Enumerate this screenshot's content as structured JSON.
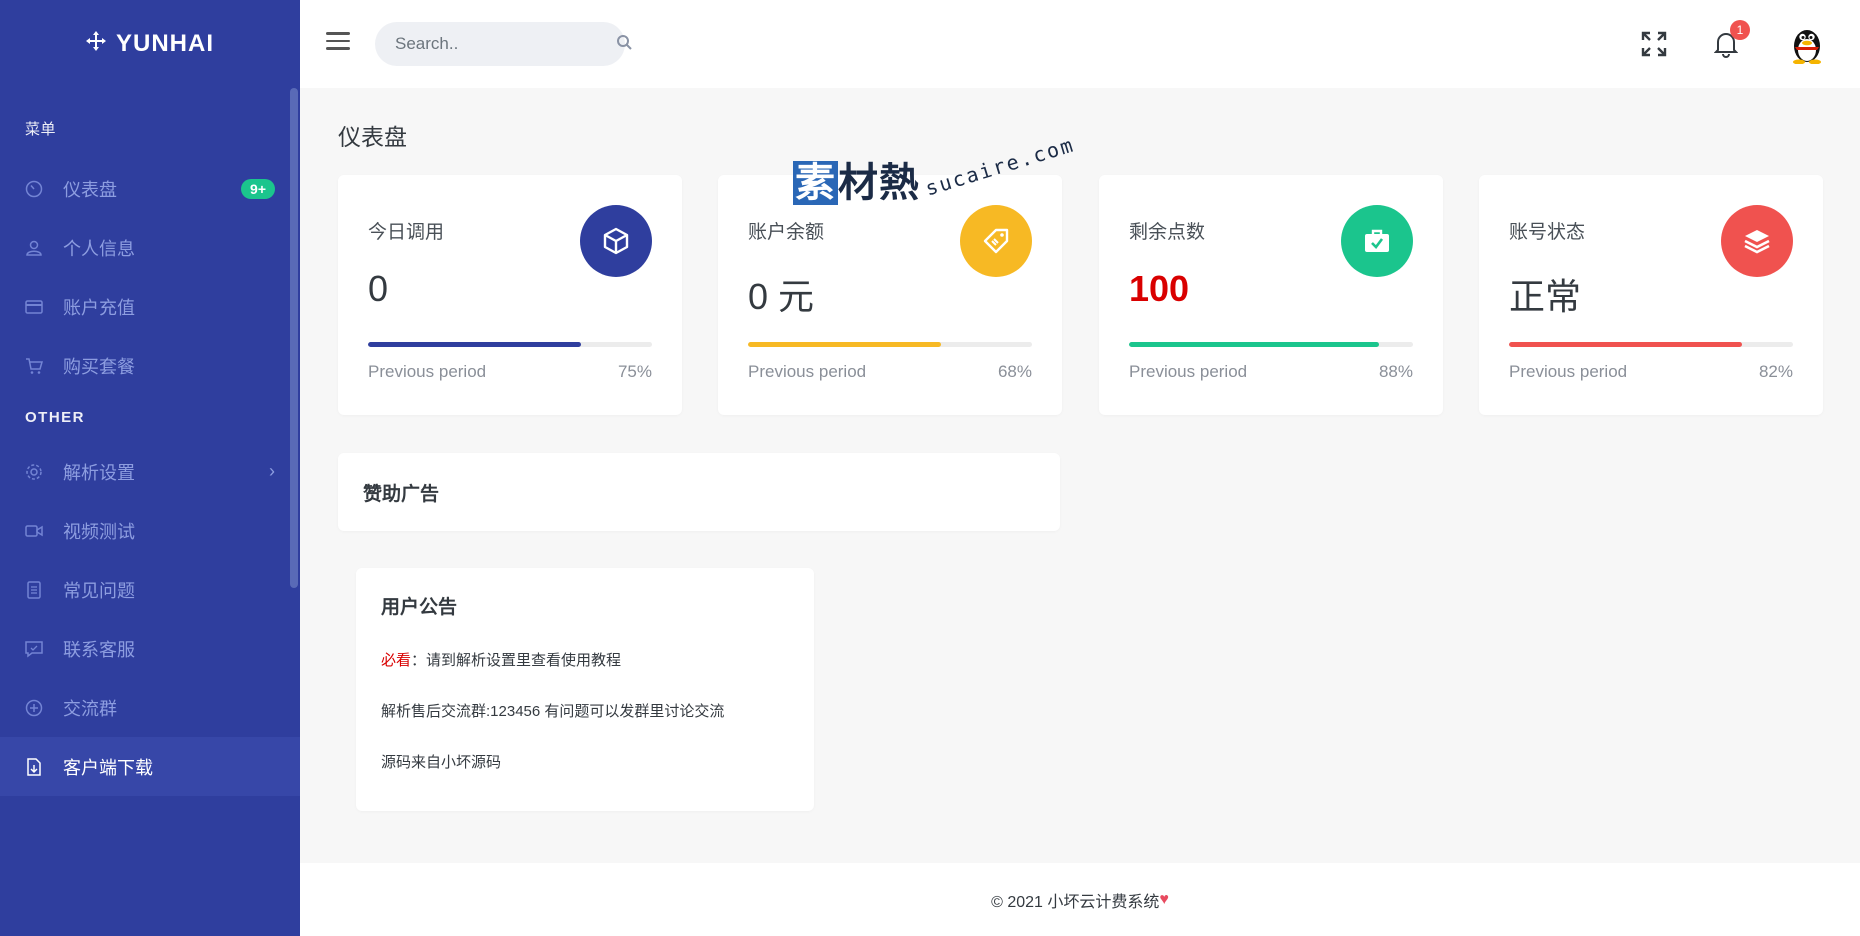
{
  "brand": {
    "name": "YUNHAI",
    "icon": "move-arrows-icon"
  },
  "sidebar": {
    "section_menu": "菜单",
    "section_other": "OTHER",
    "items": [
      {
        "label": "仪表盘",
        "icon": "dashboard-icon",
        "badge": "9+"
      },
      {
        "label": "个人信息",
        "icon": "user-icon"
      },
      {
        "label": "账户充值",
        "icon": "credit-card-icon"
      },
      {
        "label": "购买套餐",
        "icon": "cart-icon"
      },
      {
        "label": "解析设置",
        "icon": "gear-icon",
        "has_submenu": true
      },
      {
        "label": "视频测试",
        "icon": "video-icon"
      },
      {
        "label": "常见问题",
        "icon": "document-icon"
      },
      {
        "label": "联系客服",
        "icon": "chat-icon"
      },
      {
        "label": "交流群",
        "icon": "plus-circle-icon"
      },
      {
        "label": "客户端下载",
        "icon": "file-download-icon",
        "active": true
      }
    ]
  },
  "topbar": {
    "search_placeholder": "Search..",
    "notification_count": "1"
  },
  "page": {
    "title": "仪表盘"
  },
  "stats": [
    {
      "title": "今日调用",
      "value": "0",
      "previous_label": "Previous period",
      "percent": "75%",
      "progress": 0.75,
      "color": "#2f3e9e",
      "icon": "cube-icon"
    },
    {
      "title": "账户余额",
      "value": "0 元",
      "previous_label": "Previous period",
      "percent": "68%",
      "progress": 0.68,
      "color": "#f7b924",
      "icon": "price-tag-icon"
    },
    {
      "title": "剩余点数",
      "value": "100",
      "previous_label": "Previous period",
      "percent": "88%",
      "progress": 0.88,
      "color": "#1bc58d",
      "icon": "briefcase-check-icon"
    },
    {
      "title": "账号状态",
      "value": "正常",
      "previous_label": "Previous period",
      "percent": "82%",
      "progress": 0.82,
      "color": "#f0524f",
      "icon": "layers-icon"
    }
  ],
  "ad": {
    "title": "赞助广告"
  },
  "notice": {
    "title": "用户公告",
    "line1_prefix": "必看",
    "line1_text": "：请到解析设置里查看使用教程",
    "line2": "解析售后交流群:123456 有问题可以发群里讨论交流",
    "line3": "源码来自小坏源码"
  },
  "footer": {
    "text": "© 2021 小坏云计费系统",
    "heart": "♥"
  },
  "watermark": {
    "cn_first": "素",
    "cn_rest": "材熱",
    "en": "sucaire.com"
  }
}
